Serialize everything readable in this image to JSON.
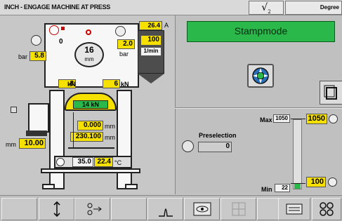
{
  "title_bar": {
    "title": "INCH - ENGAGE MACHINE AT PRESS",
    "sqrt_label": "√",
    "sqrt_sub": "2",
    "right_label": "Degree"
  },
  "machine": {
    "top_value": "0",
    "die_size": "16",
    "die_unit": "mm",
    "pressure_value": "5.8",
    "pressure_unit": "bar",
    "current_value": "26.4",
    "current_unit": "A",
    "pressure2_value": "2.0",
    "pressure2_unit": "bar",
    "speed_value": "100",
    "speed_unit": "1/min",
    "force_left": "8",
    "force_right": "6",
    "force_unit": "kN",
    "ram_force": "14",
    "ram_force_unit": "kN",
    "pos1_value": "0.000",
    "pos1_unit": "mm",
    "pos2_value": "230.100",
    "pos2_unit": "mm",
    "side_value": "10.00",
    "side_unit": "mm",
    "temp_set": "35.0",
    "temp_actual": "22.4",
    "temp_unit": "°C"
  },
  "right": {
    "mode_label": "Stampmode",
    "preselection_label": "Preselection",
    "preselection_value": "0",
    "max_label": "Max",
    "max_value": "1050",
    "max_setting": "1050",
    "min_label": "Min",
    "min_value": "22",
    "min_setting": "100",
    "slider_level_fraction": 0.08
  },
  "toolbar": {
    "icons": [
      "blank",
      "up-down-arrow-icon",
      "stroke-icon",
      "blank",
      "peak-curve-icon",
      "eye-view-icon",
      "disabled-grid-icon",
      "blank",
      "keyboard-icon",
      "gear-cluster-icon"
    ]
  }
}
